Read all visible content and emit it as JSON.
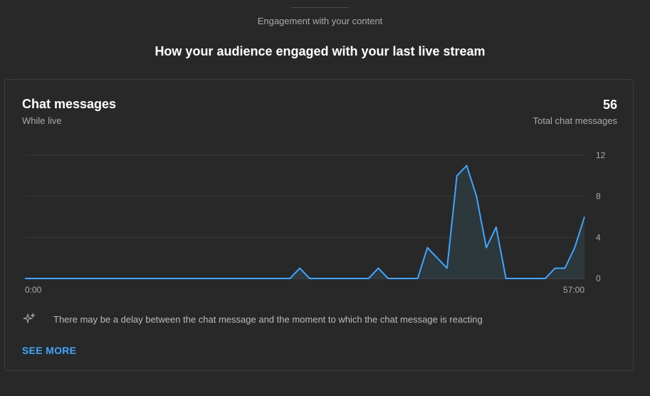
{
  "header": {
    "section_label": "Engagement with your content",
    "title": "How your audience engaged with your last live stream"
  },
  "card": {
    "title": "Chat messages",
    "subtitle": "While live",
    "total_value": "56",
    "total_label": "Total chat messages",
    "note_icon": "sparkle-icon",
    "note": "There may be a delay between the chat message and the moment to which the chat message is reacting",
    "see_more": "SEE MORE"
  },
  "colors": {
    "line": "#3ea6ff",
    "area": "#2e3a3f",
    "grid": "#3a3a3a",
    "link": "#3ea6ff"
  },
  "chart_data": {
    "type": "area",
    "x_start_label": "0:00",
    "x_end_label": "57:00",
    "x_range": [
      0,
      57
    ],
    "yticks": [
      0,
      4,
      8,
      12
    ],
    "ylim": [
      0,
      12
    ],
    "values": [
      0,
      0,
      0,
      0,
      0,
      0,
      0,
      0,
      0,
      0,
      0,
      0,
      0,
      0,
      0,
      0,
      0,
      0,
      0,
      0,
      0,
      0,
      0,
      0,
      0,
      0,
      0,
      0,
      1,
      0,
      0,
      0,
      0,
      0,
      0,
      0,
      1,
      0,
      0,
      0,
      0,
      3,
      2,
      1,
      10,
      11,
      8,
      3,
      5,
      0,
      0,
      0,
      0,
      0,
      1,
      1,
      3,
      6
    ]
  }
}
